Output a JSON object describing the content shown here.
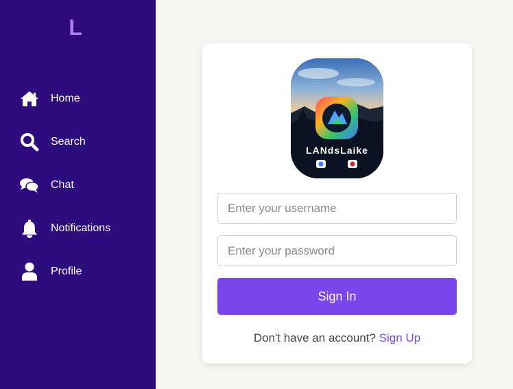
{
  "sidebar": {
    "logo": "L",
    "items": [
      {
        "label": "Home",
        "icon": "home-icon"
      },
      {
        "label": "Search",
        "icon": "search-icon"
      },
      {
        "label": "Chat",
        "icon": "chat-icon"
      },
      {
        "label": "Notifications",
        "icon": "bell-icon"
      },
      {
        "label": "Profile",
        "icon": "user-icon"
      }
    ]
  },
  "login": {
    "app_logo_text": "LANdsLaike",
    "username_placeholder": "Enter your username",
    "password_placeholder": "Enter your password",
    "sign_in_label": "Sign In",
    "signup_prompt": "Don't have an account?",
    "signup_link": "Sign Up"
  },
  "colors": {
    "sidebar_bg": "#2e0c7e",
    "logo_accent": "#b07cf2",
    "primary": "#7a45ea",
    "page_bg": "#f7f6f3"
  }
}
